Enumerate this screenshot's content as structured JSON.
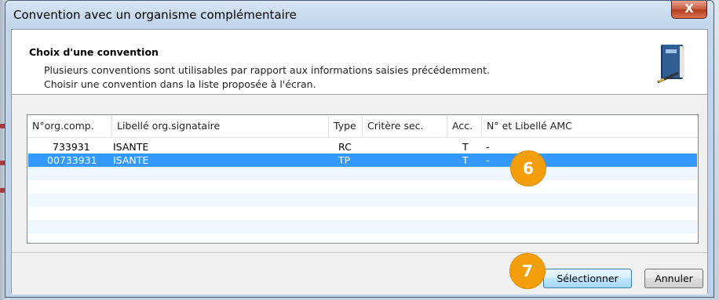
{
  "window": {
    "title": "Convention avec un organisme complémentaire",
    "close_label": "X"
  },
  "header": {
    "title": "Choix d'une convention",
    "line1": "Plusieurs conventions sont utilisables par rapport aux informations saisies précédemment.",
    "line2": "Choisir une convention dans la liste proposée à l'écran.",
    "icon": "address-book-icon"
  },
  "table": {
    "columns": [
      "N°org.comp.",
      "Libellé org.signataire",
      "Type",
      "Critère sec.",
      "Acc.",
      "N° et Libellé AMC"
    ],
    "rows": [
      {
        "org": "733931",
        "libelle": "ISANTE",
        "type": "RC",
        "critere": "",
        "acc": "T",
        "amc": "-"
      },
      {
        "org": "00733931",
        "libelle": "ISANTE",
        "type": "TP",
        "critere": "",
        "acc": "T",
        "amc": "-"
      }
    ],
    "selected_row": 1
  },
  "buttons": {
    "select_label": "Sélectionner",
    "cancel_label": "Annuler"
  },
  "badges": {
    "step6": "6",
    "step7": "7",
    "color": "#f59e0b"
  }
}
